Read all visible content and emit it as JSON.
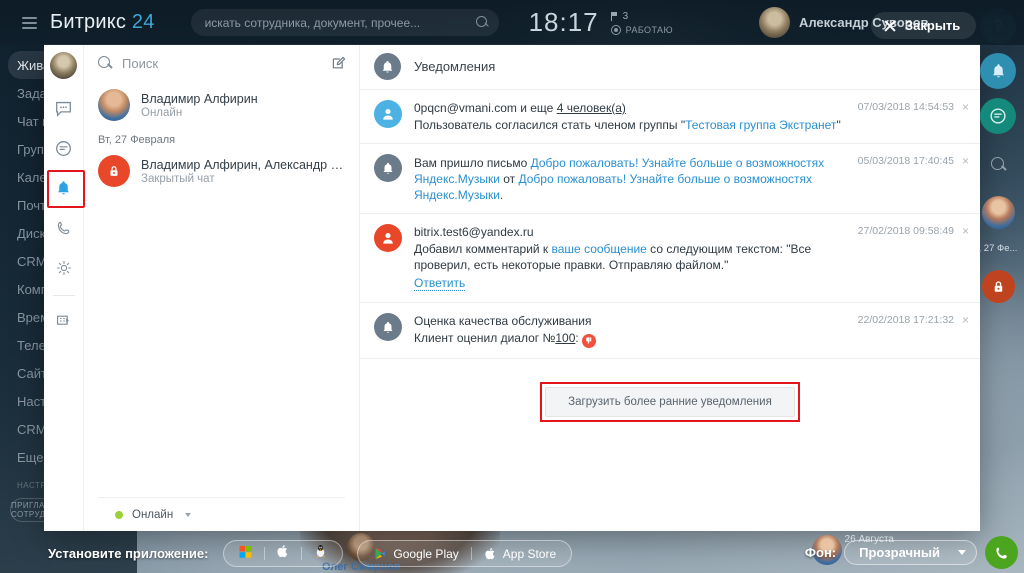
{
  "topbar": {
    "logo_text": "Битрикс",
    "logo_num": "24",
    "search_placeholder": "искать сотрудника, документ, прочее...",
    "search_value": "",
    "clock": "18:17",
    "flag_count": "3",
    "work_status": "РАБОТАЮ",
    "user_name": "Александр Суворов",
    "close_label": "Закрыть"
  },
  "leftnav": {
    "items": [
      {
        "label": "Живая лента",
        "active": true
      },
      {
        "label": "Задачи",
        "active": false
      },
      {
        "label": "Чат и звонки",
        "active": false
      },
      {
        "label": "Группы",
        "active": false
      },
      {
        "label": "Календарь",
        "active": false
      },
      {
        "label": "Почта",
        "active": false
      },
      {
        "label": "Диск",
        "active": false
      },
      {
        "label": "CRM",
        "active": false
      },
      {
        "label": "Компания",
        "active": false
      },
      {
        "label": "Время и отчеты",
        "active": false
      },
      {
        "label": "Телефония",
        "active": false
      },
      {
        "label": "Сайты",
        "active": false
      },
      {
        "label": "Настройки",
        "active": false
      },
      {
        "label": "CRM-маркетинг",
        "active": false
      },
      {
        "label": "Еще",
        "active": false
      }
    ],
    "section_label": "НАСТРОИТЬ МЕНЮ",
    "invite_label": "ПРИГЛАСИТЬ СОТРУДНИКОВ"
  },
  "messenger": {
    "rail": {
      "icons": [
        {
          "name": "chat-icon",
          "selected": false
        },
        {
          "name": "openlines-icon",
          "selected": false
        },
        {
          "name": "bell-icon",
          "selected": true
        },
        {
          "name": "phone-icon",
          "selected": false
        },
        {
          "name": "gear-icon",
          "selected": false
        },
        {
          "name": "apps-icon",
          "selected": false
        }
      ]
    },
    "search_placeholder": "Поиск",
    "search_value": "",
    "chats": [
      {
        "name": "Владимир Алфирин",
        "sub": "Онлайн",
        "avatar": "photo"
      }
    ],
    "day_label": "Вт, 27 Февраля",
    "chats2": [
      {
        "name": "Владимир Алфирин, Александр Тр...",
        "sub": "Закрытый чат",
        "avatar": "lock"
      }
    ],
    "status_label": "Онлайн"
  },
  "notifications": {
    "header_title": "Уведомления",
    "items": [
      {
        "avatar": "blue",
        "title_plain": "0pqcn@vmani.com и еще ",
        "title_link": "4 человек(а)",
        "text_pre": "Пользователь согласился стать членом группы \"",
        "text_link": "Тестовая группа Экстранет",
        "text_post": "\"",
        "time": "07/03/2018 14:54:53",
        "reply": ""
      },
      {
        "avatar": "grey",
        "title_plain": "",
        "title_link": "",
        "text_pre": "Вам пришло письмо ",
        "text_link": "Добро пожаловать! Узнайте больше о возможностях Яндекс.Музыки",
        "text_mid": " от ",
        "text_link2": "Добро пожаловать! Узнайте больше о возможностях Яндекс.Музыки",
        "text_post": ".",
        "time": "05/03/2018 17:40:45",
        "reply": ""
      },
      {
        "avatar": "red",
        "title_plain": "bitrix.test6@yandex.ru",
        "title_link": "",
        "text_pre": "Добавил комментарий к ",
        "text_link": "ваше сообщение",
        "text_post": " со следующим текстом: \"Все проверил, есть некоторые правки. Отправляю файлом.\"",
        "time": "27/02/2018 09:58:49",
        "reply": "Ответить"
      },
      {
        "avatar": "grey",
        "title_plain": "Оценка качества обслуживания",
        "title_link": "",
        "text_pre": "Клиент оценил диалог №",
        "text_ulink": "100",
        "text_post": ":",
        "time": "22/02/2018 17:21:32",
        "reply": ""
      }
    ],
    "close_glyph": "×",
    "load_more_label": "Загрузить более ранние уведомления"
  },
  "rightrail": {
    "help_glyph": "?",
    "date_label": ", 27 Фе...",
    "icons": [
      "help-icon",
      "bell-icon",
      "chat-icon",
      "search-icon",
      "avatar",
      "lock-icon"
    ]
  },
  "bottombar": {
    "install_label": "Установите приложение:",
    "os_icons": [
      "windows-icon",
      "apple-icon",
      "linux-icon"
    ],
    "google_play_label": "Google Play",
    "app_store_label": "App Store",
    "person_name": "Олег Смирнов",
    "bg_label": "Фон:",
    "bg_value": "Прозрачный",
    "right_date": "26 Августа"
  },
  "colors": {
    "accent_blue": "#2a8fd0",
    "highlight_red": "#e4161b",
    "online_green": "#9dcf38",
    "brand_dark": "#12222e"
  }
}
